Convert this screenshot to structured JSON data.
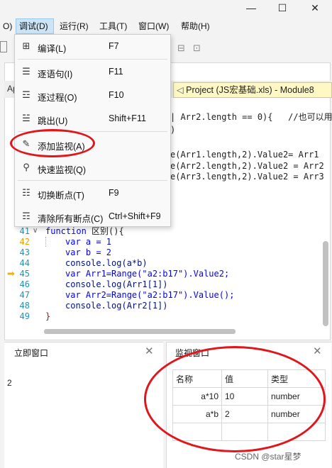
{
  "menubar": {
    "items": [
      "O)",
      "调试(D)",
      "运行(R)",
      "工具(T)",
      "窗口(W)",
      "帮助(H)"
    ]
  },
  "window_controls": {
    "minimize": "—",
    "maximize": "☐",
    "close": "✕"
  },
  "editor": {
    "left_tab_fragment": "Ap",
    "doc_tab": "Project (JS宏基础.xls) - Module8",
    "top_lines": [
      "| Arr2.length == 0){   //也可以用",
      ")",
      "e(Arr1.length,2).Value2= Arr1",
      "e(Arr2.length,2).Value2 = Arr2",
      "e(Arr3.length,2).Value2 = Arr3"
    ],
    "line_numbers": [
      "41",
      "42",
      "43",
      "44",
      "45",
      "46",
      "47",
      "48",
      "49"
    ],
    "code": {
      "l41_kw": "function",
      "l41_name": " 区别(){",
      "l42": "var a = 1",
      "l43": "var b = 2",
      "l44": "console.log(a*b)",
      "l45": "var Arr1=Range(\"a2:b17\").Value2;",
      "l46": "console.log(Arr1[1])",
      "l47": "var Arr2=Range(\"a2:b17\").Value();",
      "l48": "console.log(Arr2[1])",
      "l49": "}"
    }
  },
  "debug_menu": {
    "items": [
      {
        "label": "编译(L)",
        "shortcut": "F7",
        "icon": "compile-icon"
      },
      {
        "label": "逐语句(I)",
        "shortcut": "F11",
        "icon": "step-into-icon"
      },
      {
        "label": "逐过程(O)",
        "shortcut": "F10",
        "icon": "step-over-icon"
      },
      {
        "label": "跳出(U)",
        "shortcut": "Shift+F11",
        "icon": "step-out-icon"
      },
      {
        "label": "添加监视(A)",
        "shortcut": "",
        "icon": "add-watch-icon"
      },
      {
        "label": "快速监视(Q)",
        "shortcut": "",
        "icon": "quick-watch-icon"
      },
      {
        "label": "切换断点(T)",
        "shortcut": "F9",
        "icon": "toggle-breakpoint-icon"
      },
      {
        "label": "清除所有断点(C)",
        "shortcut": "Ctrl+Shift+F9",
        "icon": "clear-breakpoints-icon"
      }
    ]
  },
  "immediate": {
    "title": "立即窗口",
    "output": "2"
  },
  "watch": {
    "title": "监视窗口",
    "headers": [
      "名称",
      "值",
      "类型"
    ],
    "rows": [
      {
        "name": "a*10",
        "value": "10",
        "type": "number"
      },
      {
        "name": "a*b",
        "value": "2",
        "type": "number"
      }
    ]
  },
  "watermark": "CSDN @star星梦",
  "colors": {
    "annotation": "#e0161b",
    "menu_highlight": "#cce4f7",
    "doc_tab_bg": "#fff8c5",
    "breakpoint_arrow": "#f0b400"
  }
}
